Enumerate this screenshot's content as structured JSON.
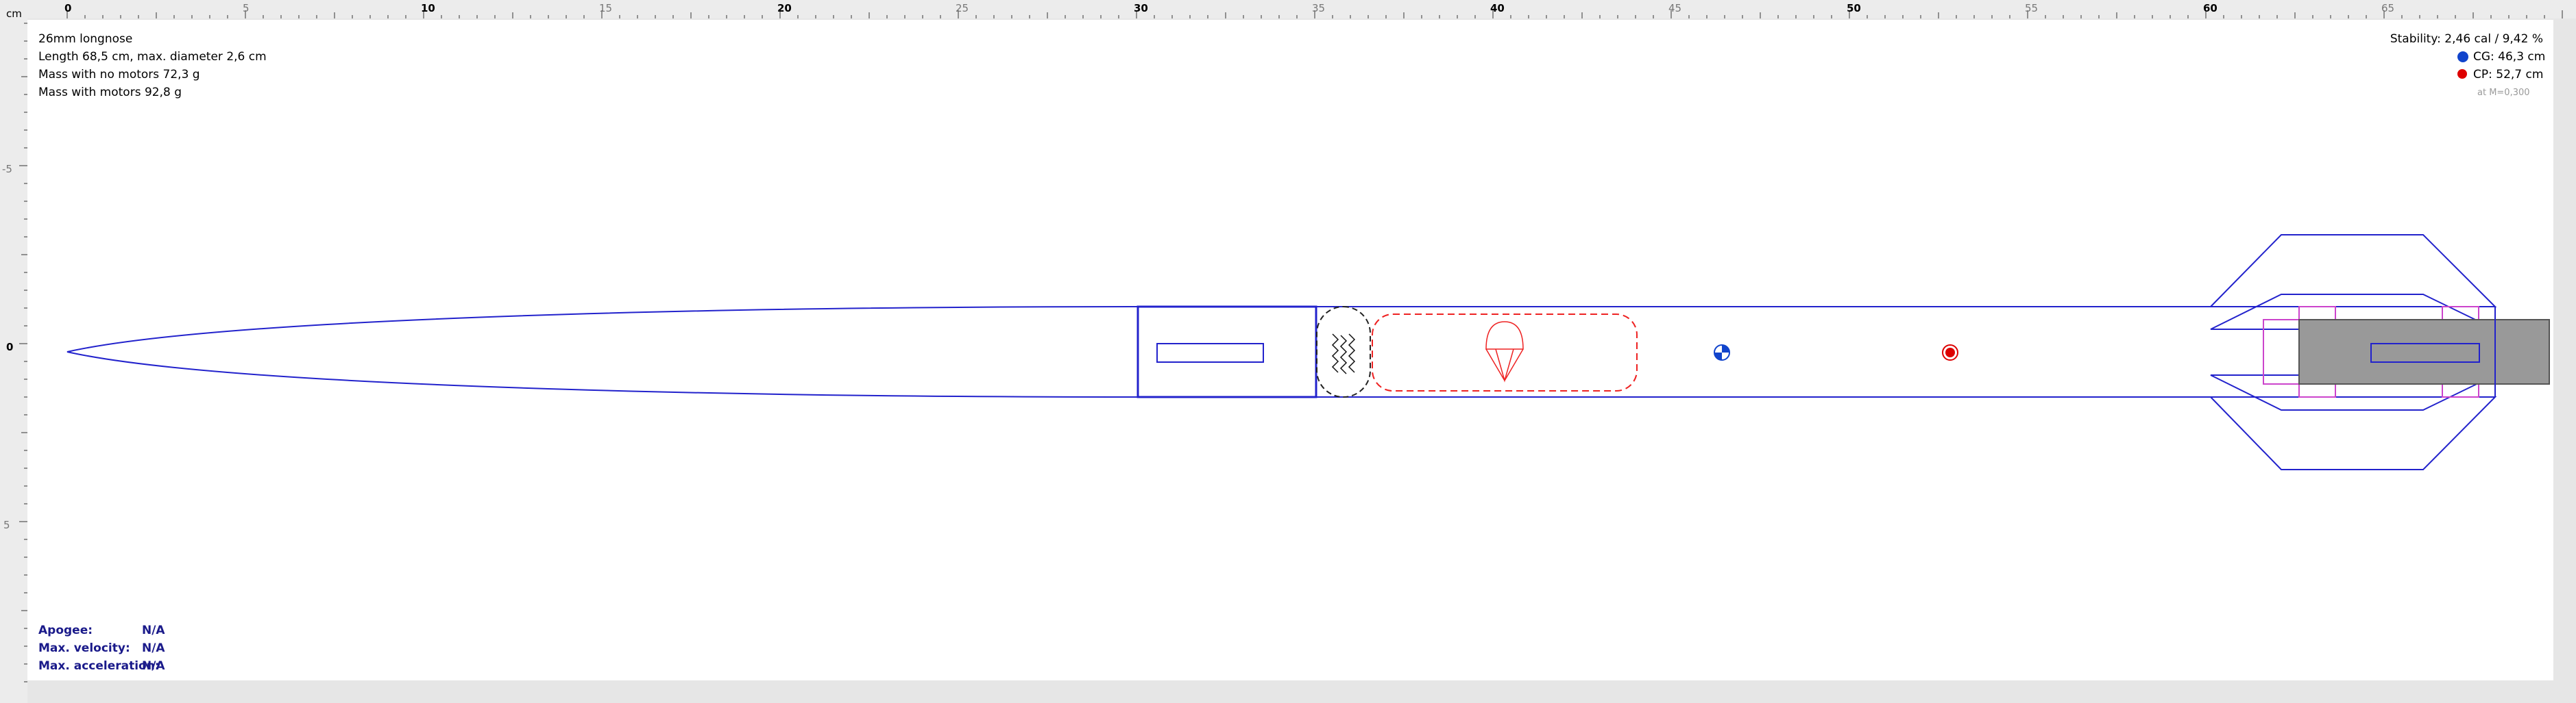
{
  "ruler": {
    "unit": "cm",
    "h_labels": [
      "0",
      "5",
      "10",
      "15",
      "20",
      "25",
      "30",
      "35",
      "40",
      "45",
      "50",
      "55",
      "60",
      "65"
    ],
    "v_labels": [
      "-5",
      "0",
      "5"
    ]
  },
  "info": {
    "name": "26mm longnose",
    "length": "Length 68,5 cm, max. diameter 2,6 cm",
    "mass_no_motors": "Mass with no motors 72,3 g",
    "mass_with_motors": "Mass with motors 92,8 g"
  },
  "stability": {
    "text": "Stability: 2,46 cal / 9,42 %",
    "cg": "CG: 46,3 cm",
    "cp": "CP: 52,7 cm",
    "mach": "at M=0,300"
  },
  "flight": {
    "apogee_label": "Apogee:",
    "apogee_value": "N/A",
    "velocity_label": "Max. velocity:",
    "velocity_value": "N/A",
    "accel_label": "Max. acceleration:",
    "accel_value": "N/A"
  },
  "colors": {
    "outline": "#2222cc",
    "recovery": "#ee2222",
    "cg_marker": "#1144cc",
    "cp_marker": "#dd0000",
    "motor_fill": "#999999",
    "inner_tube": "#cc44cc"
  }
}
